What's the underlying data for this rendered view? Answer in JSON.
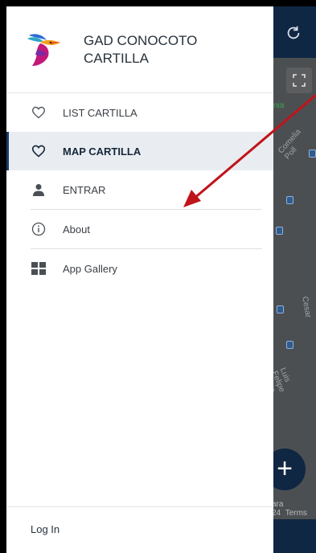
{
  "app": {
    "title": "GAD CONOCOTO CARTILLA",
    "title_line1": "GAD CONOCOTO",
    "title_line2": "CARTILLA"
  },
  "drawer": {
    "items": [
      {
        "label": "LIST CARTILLA",
        "icon": "heart-outline-icon"
      },
      {
        "label": "MAP CARTILLA",
        "icon": "heart-outline-icon",
        "active": true
      },
      {
        "label": "ENTRAR",
        "icon": "user-icon"
      },
      {
        "label": "About",
        "icon": "info-icon"
      },
      {
        "label": "App Gallery",
        "icon": "grid-icon"
      }
    ],
    "footer": {
      "label": "Log In"
    }
  },
  "map": {
    "labels": [
      "nia",
      "Comelia Poll",
      "Cesar",
      "Luis Felipe Borja",
      "ara",
      "24",
      "Terms"
    ]
  },
  "colors": {
    "primary": "#0f2743",
    "active_bg": "#e9edf1",
    "accent_arrow": "#c0141b"
  }
}
